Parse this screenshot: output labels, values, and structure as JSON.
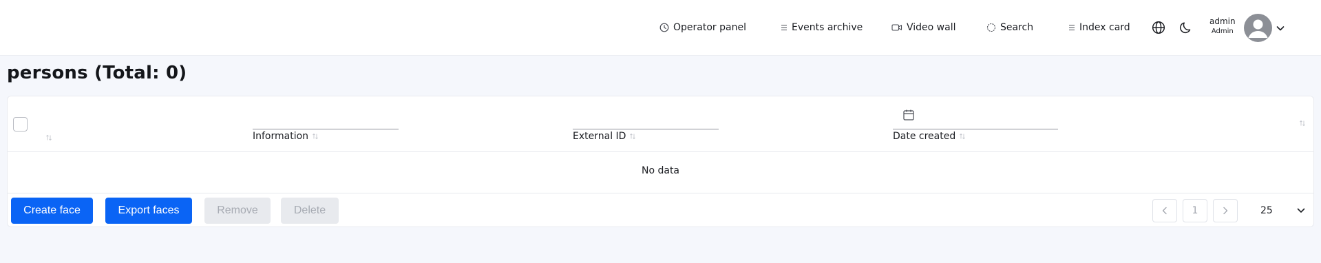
{
  "nav": {
    "items": [
      {
        "label": "Operator panel",
        "icon": "clock-icon"
      },
      {
        "label": "Events archive",
        "icon": "list-icon"
      },
      {
        "label": "Video wall",
        "icon": "video-camera-icon"
      },
      {
        "label": "Search",
        "icon": "search-target-icon"
      },
      {
        "label": "Index card",
        "icon": "list-icon"
      }
    ],
    "language_icon": "globe-icon",
    "theme_icon": "moon-icon",
    "user": {
      "name": "admin",
      "role": "Admin",
      "avatar_icon": "user-avatar-icon",
      "menu_icon": "chevron-down-icon"
    }
  },
  "page": {
    "title": "persons (Total: 0)"
  },
  "table": {
    "columns": [
      {
        "label": ""
      },
      {
        "label": "Information"
      },
      {
        "label": "External ID"
      },
      {
        "label": "Date created",
        "filter_icon": "calendar-icon"
      }
    ],
    "empty_text": "No data"
  },
  "actions": {
    "create": "Create face",
    "export": "Export faces",
    "remove": "Remove",
    "delete": "Delete"
  },
  "pagination": {
    "current_page": "1",
    "page_size": "25"
  },
  "colors": {
    "primary": "#0a64f5",
    "background": "#f5f7fc",
    "disabled_bg": "#e8eaee",
    "disabled_text": "#a7abb3"
  }
}
